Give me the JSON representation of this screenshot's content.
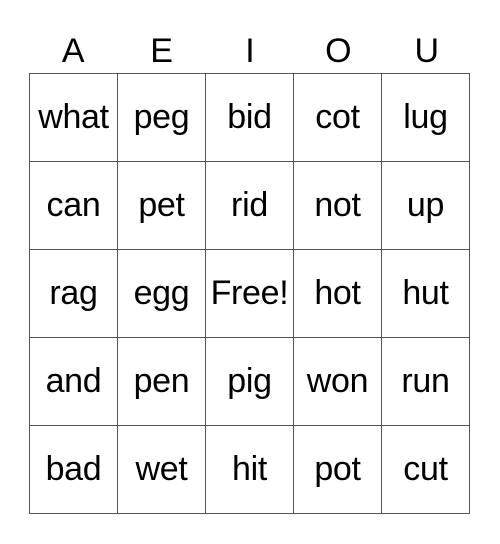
{
  "header": [
    "A",
    "E",
    "I",
    "O",
    "U"
  ],
  "rows": [
    [
      "what",
      "peg",
      "bid",
      "cot",
      "lug"
    ],
    [
      "can",
      "pet",
      "rid",
      "not",
      "up"
    ],
    [
      "rag",
      "egg",
      "Free!",
      "hot",
      "hut"
    ],
    [
      "and",
      "pen",
      "pig",
      "won",
      "run"
    ],
    [
      "bad",
      "wet",
      "hit",
      "pot",
      "cut"
    ]
  ]
}
